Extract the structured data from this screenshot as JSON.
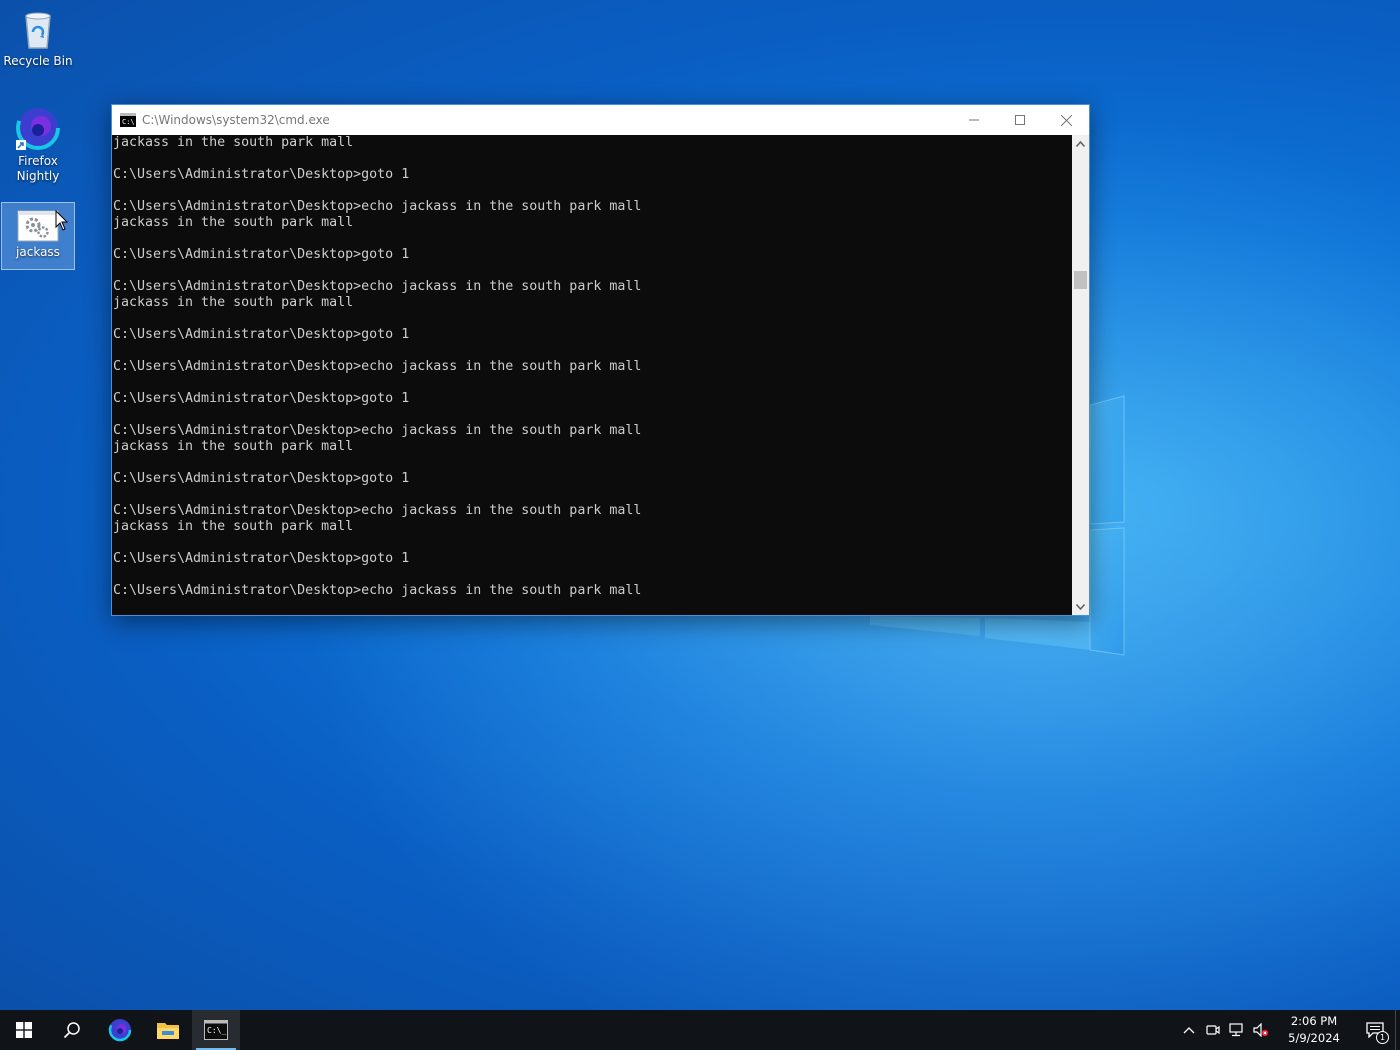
{
  "desktop": {
    "icons": [
      {
        "label": "Recycle Bin",
        "icon": "recycle-bin-icon"
      },
      {
        "label": "Firefox Nightly",
        "icon": "firefox-nightly-icon"
      },
      {
        "label": "jackass",
        "icon": "batch-file-icon",
        "selected": true
      }
    ]
  },
  "window": {
    "title": "C:\\Windows\\system32\\cmd.exe",
    "controls": [
      "minimize",
      "maximize",
      "close"
    ]
  },
  "console": {
    "lines": [
      "jackass in the south park mall",
      "",
      "C:\\Users\\Administrator\\Desktop>goto 1",
      "",
      "C:\\Users\\Administrator\\Desktop>echo jackass in the south park mall",
      "jackass in the south park mall",
      "",
      "C:\\Users\\Administrator\\Desktop>goto 1",
      "",
      "C:\\Users\\Administrator\\Desktop>echo jackass in the south park mall",
      "jackass in the south park mall",
      "",
      "C:\\Users\\Administrator\\Desktop>goto 1",
      "",
      "C:\\Users\\Administrator\\Desktop>echo jackass in the south park mall",
      "",
      "C:\\Users\\Administrator\\Desktop>goto 1",
      "",
      "C:\\Users\\Administrator\\Desktop>echo jackass in the south park mall",
      "jackass in the south park mall",
      "",
      "C:\\Users\\Administrator\\Desktop>goto 1",
      "",
      "C:\\Users\\Administrator\\Desktop>echo jackass in the south park mall",
      "jackass in the south park mall",
      "",
      "C:\\Users\\Administrator\\Desktop>goto 1",
      "",
      "C:\\Users\\Administrator\\Desktop>echo jackass in the south park mall"
    ]
  },
  "taskbar": {
    "pinned": [
      {
        "icon": "start-windows-icon"
      },
      {
        "icon": "search-icon"
      },
      {
        "icon": "firefox-nightly-icon"
      },
      {
        "icon": "file-explorer-icon"
      },
      {
        "icon": "cmd-icon",
        "active": true
      }
    ],
    "tray": {
      "icons": [
        "chevron-up-icon",
        "meet-now-icon",
        "network-icon",
        "volume-muted-icon"
      ],
      "time": "2:06 PM",
      "date": "5/9/2024",
      "notification_count": "1"
    }
  },
  "colors": {
    "console_bg": "#0c0c0c",
    "console_fg": "#cccccc",
    "taskbar_bg": "#101418",
    "active_indicator": "#76b9ed"
  }
}
